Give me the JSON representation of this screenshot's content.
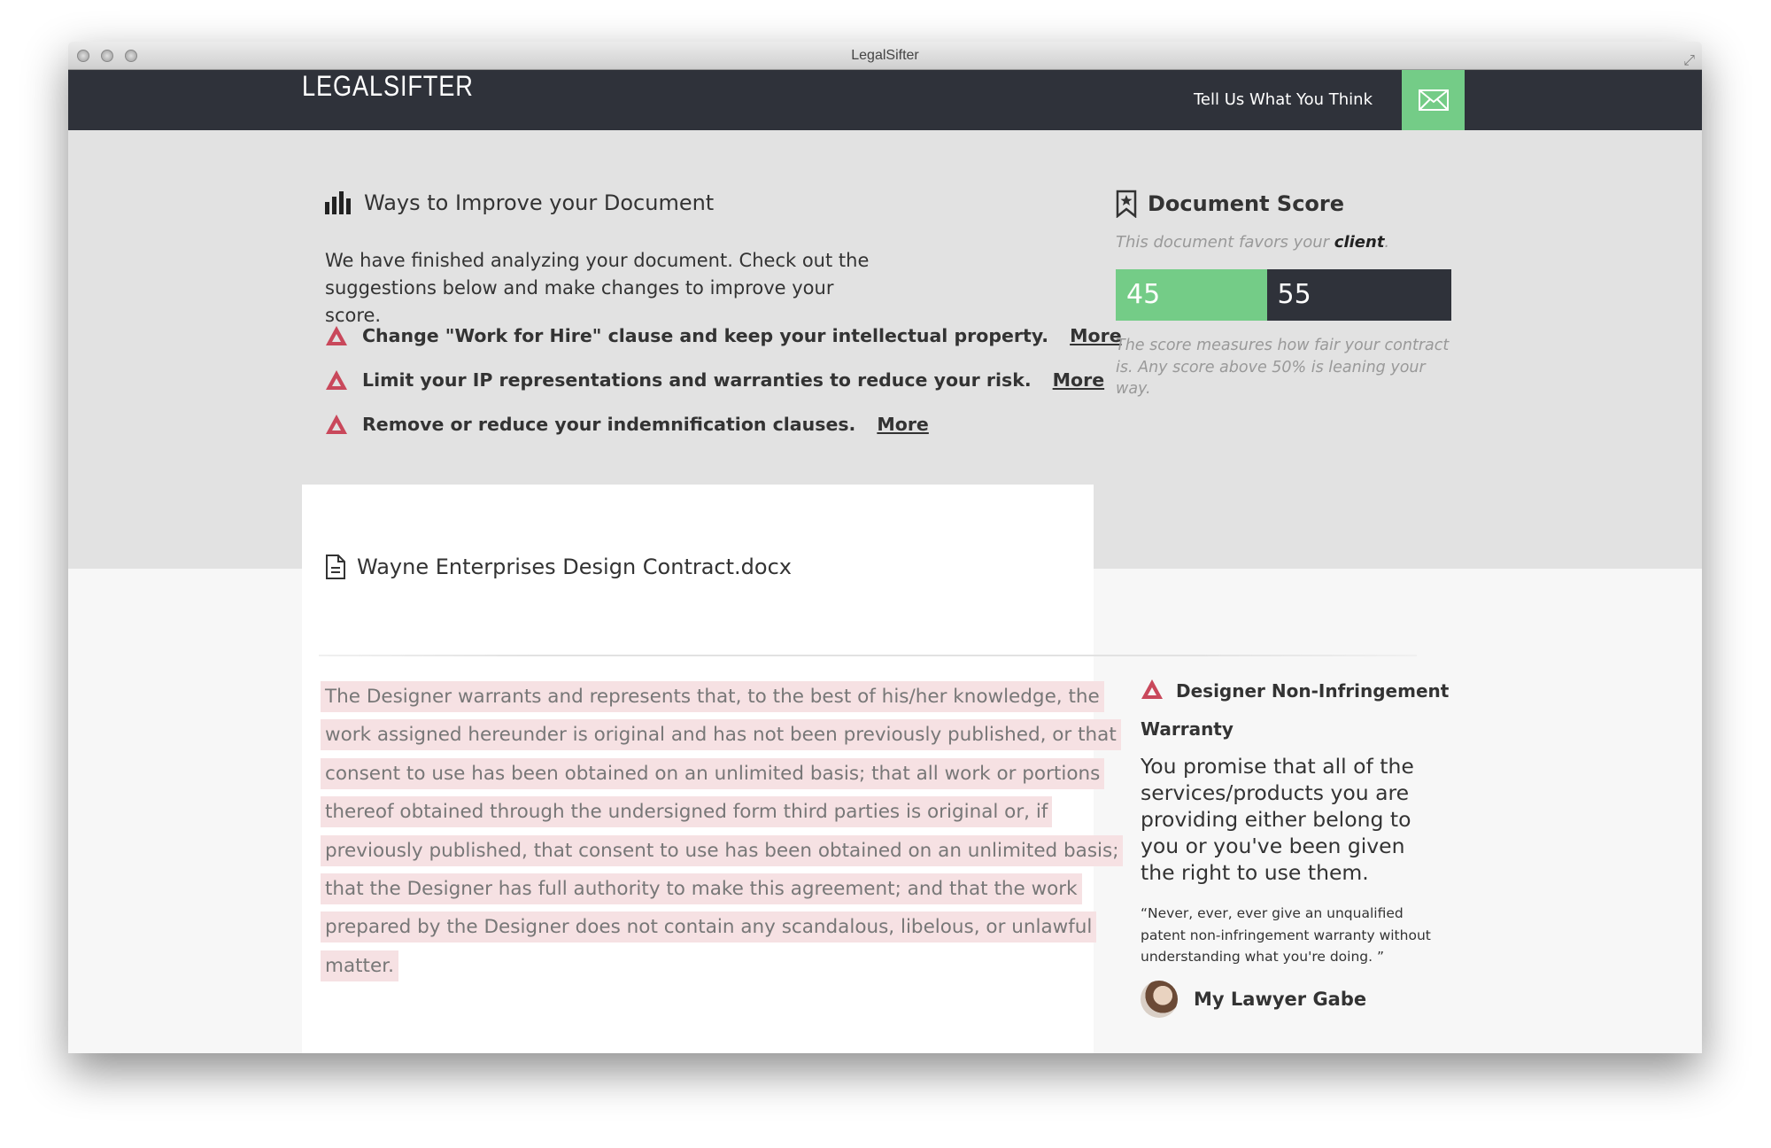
{
  "window": {
    "title": "LegalSifter"
  },
  "nav": {
    "logo": "LEGALSIFTER",
    "feedback_label": "Tell Us What You Think",
    "feedback_icon": "envelope-icon",
    "accent": "#74cc87",
    "bg": "#2f323a"
  },
  "improve": {
    "title": "Ways to Improve your Document",
    "intro": "We have finished analyzing your document. Check out the suggestions below and make changes to improve your score.",
    "items": [
      {
        "text": "Change \"Work for Hire\" clause and keep your intellectual property.",
        "link": "More"
      },
      {
        "text": "Limit your IP representations and warranties to reduce your risk.",
        "link": "More"
      },
      {
        "text": "Remove or reduce your indemnification clauses.",
        "link": "More"
      }
    ]
  },
  "score": {
    "title": "Document Score",
    "favors_prefix": "This document favors your ",
    "favors_party": "client",
    "favors_suffix": ".",
    "left_value": 45,
    "right_value": 55,
    "left_color": "#74cc87",
    "right_color": "#2f323a",
    "note": "The score measures how fair your contract is. Any score above 50% is leaning your way."
  },
  "document": {
    "filename": "Wayne Enterprises Design Contract.docx",
    "clause": "The Designer warrants and represents that, to the best of his/her knowledge, the work assigned hereunder is original and has not been previously published, or that consent to use has been obtained on an unlimited basis; that all work or portions thereof obtained through the undersigned form third parties is original or, if previously published, that consent to use has been obtained on an unlimited basis; that the Designer has full authority to make this agreement; and that the work prepared by the Designer does not contain any scandalous, libelous, or unlawful matter.",
    "highlight_color": "#f6e1e3"
  },
  "insight": {
    "title": "Designer Non-Infringement Warranty",
    "summary": "You promise that all of the services/products you are providing either belong to you or you've been given the right to use them.",
    "quote": "“Never, ever, ever give an unqualified patent non-infringement warranty without understanding what you're doing. ”",
    "author": "My Lawyer Gabe"
  },
  "warning_color": "#c9485b"
}
